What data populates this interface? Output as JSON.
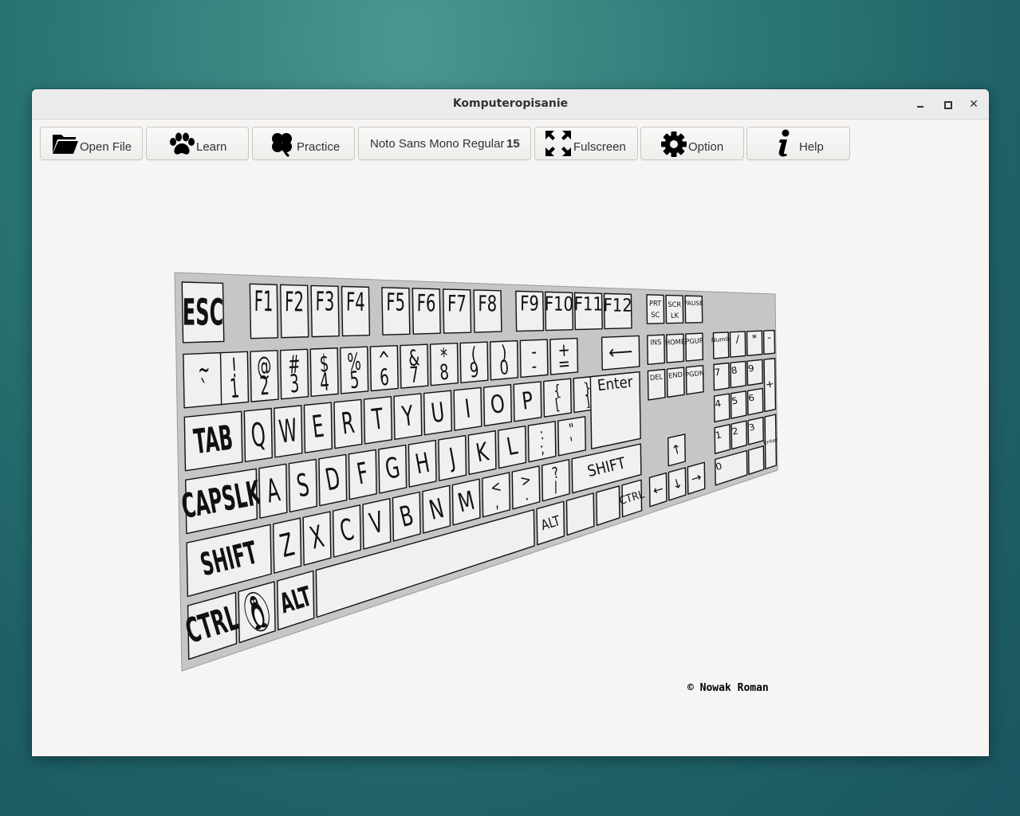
{
  "window": {
    "title": "Komputeropisanie"
  },
  "toolbar": {
    "open_file": "Open File",
    "learn": "Learn",
    "practice": "Practice",
    "font_name": "Noto Sans Mono Regular",
    "font_size": "15",
    "fullscreen": "Fulscreen",
    "option": "Option",
    "help": "Help"
  },
  "keyboard": {
    "esc": "ESC",
    "f1": "F1",
    "f2": "F2",
    "f3": "F3",
    "f4": "F4",
    "f5": "F5",
    "f6": "F6",
    "f7": "F7",
    "f8": "F8",
    "f9": "F9",
    "f10": "F10",
    "f11": "F11",
    "f12": "F12",
    "prtsc": [
      "PRT",
      "SC"
    ],
    "scrlk": [
      "SCR",
      "LK"
    ],
    "pause": "PAUSE",
    "ins": "INS",
    "home": "HOME",
    "pgup": "PGUP",
    "del": "DEL",
    "end": "END",
    "pgdn": "PGDN",
    "numlk": "Numlk",
    "num_div": "/",
    "num_mul": "*",
    "num_sub": "-",
    "num_add": "+",
    "num_enter": "Enter",
    "num": [
      "7",
      "8",
      "9",
      "4",
      "5",
      "6",
      "1",
      "2",
      "3",
      "0"
    ],
    "row1": [
      [
        "~",
        "`"
      ],
      [
        "!",
        "1"
      ],
      [
        "@",
        "2"
      ],
      [
        "#",
        "3"
      ],
      [
        "$",
        "4"
      ],
      [
        "%",
        "5"
      ],
      [
        "^",
        "6"
      ],
      [
        "&",
        "7"
      ],
      [
        "*",
        "8"
      ],
      [
        "(",
        "9"
      ],
      [
        ")",
        "0"
      ],
      [
        "-",
        "-"
      ],
      [
        "+",
        "="
      ]
    ],
    "backspace": "⟵",
    "tab": "TAB",
    "row2": [
      "Q",
      "W",
      "E",
      "R",
      "T",
      "Y",
      "U",
      "I",
      "O",
      "P"
    ],
    "row2_extra": [
      [
        "{",
        "["
      ],
      [
        "}",
        "]"
      ],
      [
        "|",
        "\\"
      ]
    ],
    "capslk": "CAPSLK",
    "row3": [
      "A",
      "S",
      "D",
      "F",
      "G",
      "H",
      "J",
      "K",
      "L"
    ],
    "row3_extra": [
      [
        ":",
        ";"
      ],
      [
        "\"",
        "'"
      ]
    ],
    "enter": "Enter",
    "shift": "SHIFT",
    "row4": [
      "Z",
      "X",
      "C",
      "V",
      "B",
      "N",
      "M"
    ],
    "row4_extra": [
      [
        "<",
        ","
      ],
      [
        ">",
        "."
      ],
      [
        "?",
        "/"
      ]
    ],
    "rshift": "SHIFT",
    "ctrl": "CTRL",
    "alt": "ALT",
    "altgr": "ALT",
    "rctrl": "CTRL",
    "arrows": {
      "up": "↑",
      "left": "←",
      "down": "↓",
      "right": "→"
    }
  },
  "footer": {
    "copyright": "© Nowak Roman"
  },
  "colors": {
    "key_face": "#f0f0f0",
    "key_border": "#111111",
    "board": "#c9c9c9"
  }
}
